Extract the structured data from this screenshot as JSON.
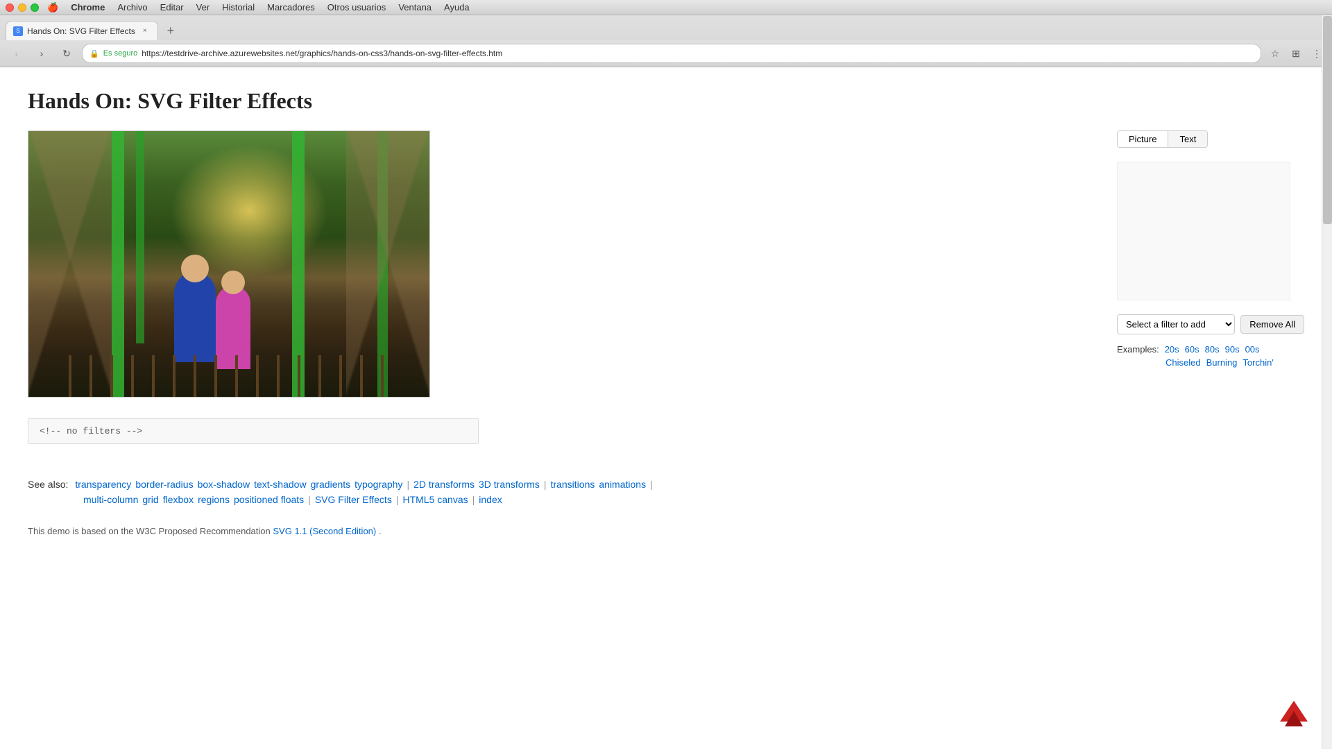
{
  "titlebar": {
    "apple_symbol": "🍎",
    "chrome_label": "Chrome",
    "menu_items": [
      "Archivo",
      "Editar",
      "Ver",
      "Historial",
      "Marcadores",
      "Otros usuarios",
      "Ventana",
      "Ayuda"
    ]
  },
  "browser": {
    "tab": {
      "title": "Hands On: SVG Filter Effects",
      "close_symbol": "×"
    },
    "new_tab_symbol": "+",
    "nav": {
      "back_symbol": "‹",
      "forward_symbol": "›",
      "refresh_symbol": "↻"
    },
    "address": {
      "secure_label": "Es seguro",
      "url": "https://testdrive-archive.azurewebsites.net/graphics/hands-on-css3/hands-on-svg-filter-effects.htm",
      "lock_symbol": "🔒"
    }
  },
  "page": {
    "title": "Hands On: SVG Filter Effects",
    "filter_tabs": {
      "picture_label": "Picture",
      "text_label": "Text"
    },
    "filter_select": {
      "placeholder": "Select a filter to add"
    },
    "remove_all_btn": "Remove All",
    "examples": {
      "label": "Examples:",
      "row1": [
        "20s",
        "60s",
        "80s",
        "90s",
        "00s"
      ],
      "row2": [
        "Chiseled",
        "Burning",
        "Torchin'"
      ]
    },
    "code_block": "<!-- no filters -->",
    "see_also": {
      "label": "See also:",
      "row1_links": [
        "transparency",
        "border-radius",
        "box-shadow",
        "text-shadow",
        "gradients",
        "typography"
      ],
      "row2_links": [
        "2D transforms",
        "3D transforms",
        "transitions",
        "animations"
      ],
      "row3_links": [
        "multi-column",
        "grid",
        "flexbox",
        "regions",
        "positioned floats"
      ],
      "row4_links": [
        "SVG Filter Effects"
      ],
      "row5_links": [
        "HTML5 canvas"
      ],
      "row6_links": [
        "index"
      ]
    },
    "footer": {
      "text": "This demo is based on the W3C Proposed Recommendation",
      "link_text": "SVG 1.1 (Second Edition)",
      "link_url": "#",
      "period": "."
    }
  },
  "logo": {
    "color_top": "#cc1111",
    "color_bottom": "#991111"
  }
}
